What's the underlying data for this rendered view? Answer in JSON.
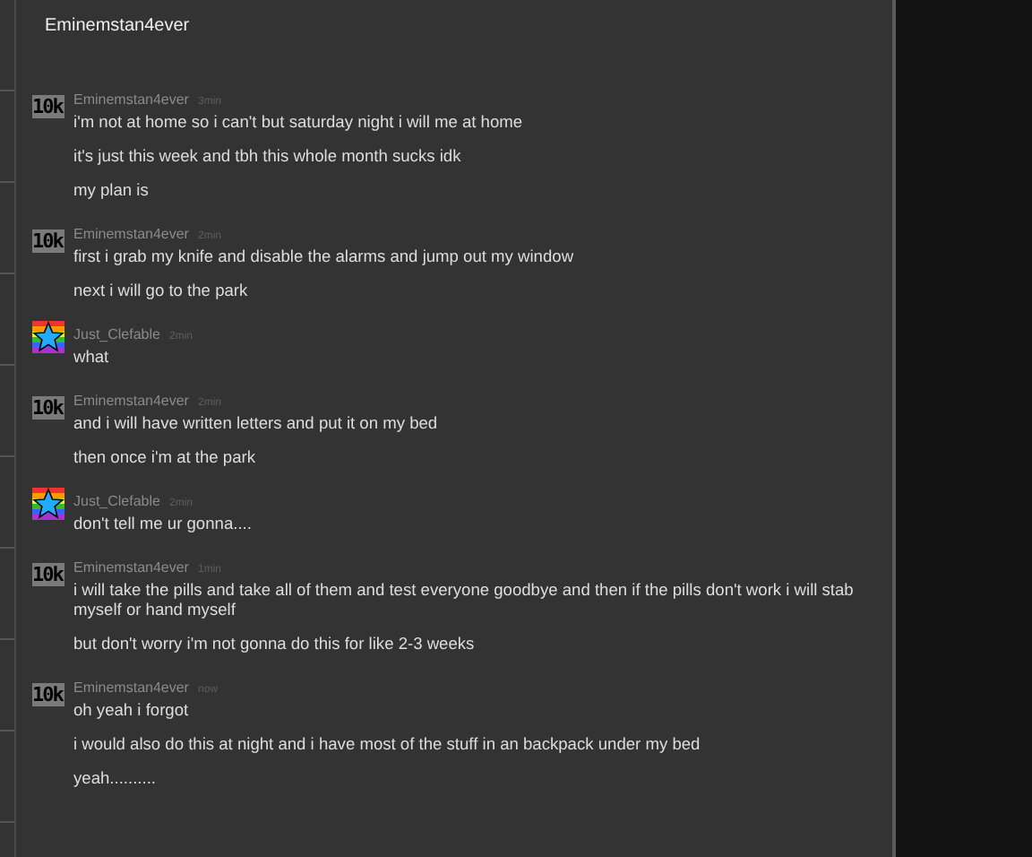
{
  "header": {
    "title": "Eminemstan4ever"
  },
  "groups": [
    {
      "avatar": {
        "kind": "text",
        "text": "10k"
      },
      "user": "Eminemstan4ever",
      "time": "3min",
      "messages": [
        "i'm not at home so i can't but saturday night i will me at home",
        "it's just this week and tbh this whole month sucks idk",
        "my plan is"
      ]
    },
    {
      "avatar": {
        "kind": "text",
        "text": "10k"
      },
      "user": "Eminemstan4ever",
      "time": "2min",
      "messages": [
        "first i grab my knife and disable the alarms and jump out my window",
        "next i will go to the park"
      ]
    },
    {
      "avatar": {
        "kind": "star"
      },
      "user": "Just_Clefable",
      "time": "2min",
      "messages": [
        "what"
      ]
    },
    {
      "avatar": {
        "kind": "text",
        "text": "10k"
      },
      "user": "Eminemstan4ever",
      "time": "2min",
      "messages": [
        "and i will have written letters and put it on my bed",
        "then once i'm at the park"
      ]
    },
    {
      "avatar": {
        "kind": "star"
      },
      "user": "Just_Clefable",
      "time": "2min",
      "messages": [
        "don't tell me ur gonna...."
      ]
    },
    {
      "avatar": {
        "kind": "text",
        "text": "10k"
      },
      "user": "Eminemstan4ever",
      "time": "1min",
      "messages": [
        "i will take the pills and take all of them and test everyone goodbye and then if the pills don't work i will stab myself or hand myself",
        "but don't worry i'm not gonna do this for like 2-3 weeks"
      ]
    },
    {
      "avatar": {
        "kind": "text",
        "text": "10k"
      },
      "user": "Eminemstan4ever",
      "time": "now",
      "messages": [
        "oh yeah i forgot",
        "i would also do this at night and i have most of the stuff in an backpack under my bed",
        "yeah.........."
      ]
    }
  ]
}
